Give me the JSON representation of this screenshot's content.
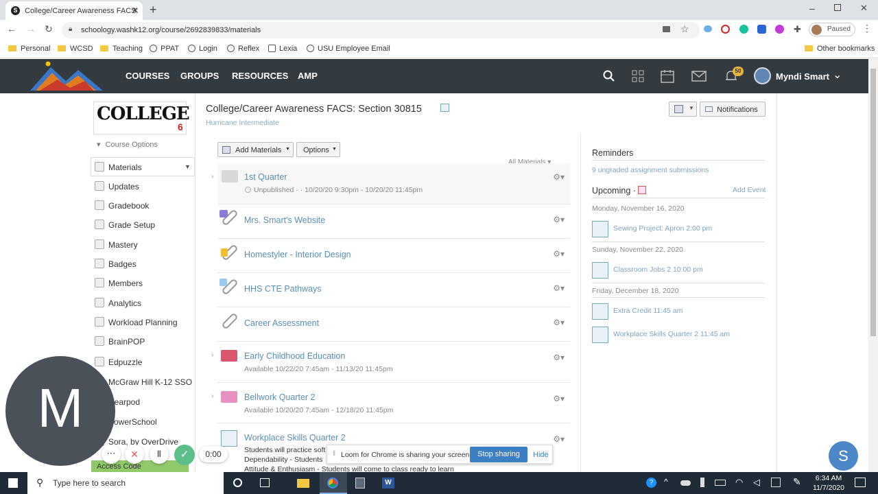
{
  "browser": {
    "tab_title": "College/Career Awareness FACS:",
    "url": "schoology.washk12.org/course/2692839833/materials",
    "profile_status": "Paused",
    "bookmarks": [
      "Personal",
      "WCSD",
      "Teaching",
      "PPAT",
      "Login",
      "Reflex",
      "Lexia",
      "USU Employee Email"
    ],
    "other_bookmarks": "Other bookmarks"
  },
  "header": {
    "nav": [
      "COURSES",
      "GROUPS",
      "RESOURCES",
      "AMP"
    ],
    "notif_count": "50",
    "user_name": "Myndi Smart"
  },
  "sidebar": {
    "course_options": "Course Options",
    "items": [
      "Materials",
      "Updates",
      "Gradebook",
      "Grade Setup",
      "Mastery",
      "Badges",
      "Members",
      "Analytics",
      "Workload Planning",
      "BrainPOP",
      "Edpuzzle",
      "McGraw Hill K-12 SSO",
      "Nearpod",
      "PowerSchool",
      "Sora, by OverDrive"
    ],
    "access_code": "Access Code"
  },
  "course": {
    "title": "College/Career Awareness FACS: Section 30815",
    "school": "Hurricane Intermediate",
    "notifications_label": "Notifications",
    "add_materials": "Add Materials",
    "options": "Options",
    "all_materials": "All Materials"
  },
  "materials": [
    {
      "title": "1st Quarter",
      "sub": "Unpublished · · 10/20/20 9:30pm - 10/20/20 11:45pm"
    },
    {
      "title": "Mrs. Smart's Website",
      "sub": ""
    },
    {
      "title": "Homestyler - Interior Design",
      "sub": ""
    },
    {
      "title": "HHS CTE Pathways",
      "sub": ""
    },
    {
      "title": "Career Assessment",
      "sub": ""
    },
    {
      "title": "Early Childhood Education",
      "sub": "Available 10/22/20 7:45am - 11/13/20 11:45pm"
    },
    {
      "title": "Bellwork Quarter 2",
      "sub": "Available 10/20/20 7:45am - 12/18/20 11:45pm"
    },
    {
      "title": "Workplace Skills Quarter 2",
      "sub": "Students will practice soft"
    },
    {
      "title": "",
      "sub": "Dependability - Students"
    },
    {
      "title": "",
      "sub": "Attitude & Enthusiasm - Students will come to class ready to learn"
    }
  ],
  "reminders": {
    "title": "Reminders",
    "ungraded": "9 ungraded assignment submissions",
    "upcoming": "Upcoming ·",
    "add_event": "Add Event",
    "groups": [
      {
        "date": "Monday, November 16, 2020",
        "items": [
          {
            "name": "Sewing Project: Apron",
            "time": "2:00 pm"
          }
        ]
      },
      {
        "date": "Sunday, November 22, 2020",
        "items": [
          {
            "name": "Classroom Jobs 2",
            "time": "10:00 pm"
          }
        ]
      },
      {
        "date": "Friday, December 18, 2020",
        "items": [
          {
            "name": "Extra Credit",
            "time": "11:45 am"
          },
          {
            "name": "Workplace Skills Quarter 2",
            "time": "11:45 am"
          }
        ]
      }
    ]
  },
  "loom": {
    "avatar_letter": "M",
    "timer": "0:00",
    "message": "Loom for Chrome is sharing your screen.",
    "stop": "Stop sharing",
    "hide": "Hide"
  },
  "chat_letter": "S",
  "taskbar": {
    "search_placeholder": "Type here to search",
    "time": "6:34 AM",
    "date": "11/7/2020"
  },
  "colors": {
    "header": "#333a40",
    "link": "#5a8fb3",
    "accent": "#3d7fc4"
  }
}
